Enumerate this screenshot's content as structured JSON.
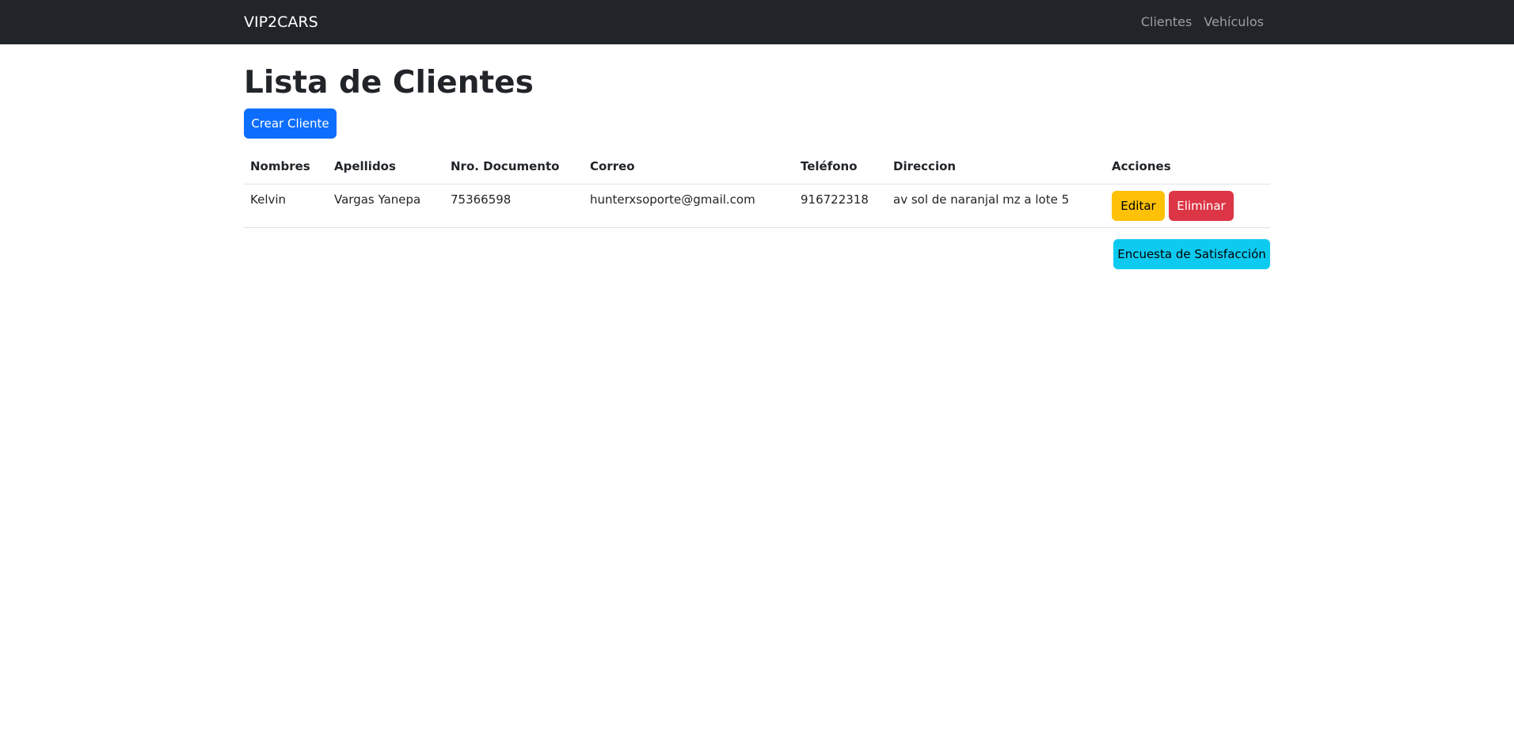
{
  "navbar": {
    "brand": "VIP2CARS",
    "links": [
      "Clientes",
      "Vehículos"
    ]
  },
  "page": {
    "title": "Lista de Clientes",
    "create_button": "Crear Cliente",
    "survey_button": "Encuesta de Satisfacción"
  },
  "table": {
    "headers": [
      "Nombres",
      "Apellidos",
      "Nro. Documento",
      "Correo",
      "Teléfono",
      "Direccion",
      "Acciones"
    ],
    "rows": [
      {
        "nombres": "Kelvin",
        "apellidos": "Vargas Yanepa",
        "documento": "75366598",
        "correo": "hunterxsoporte@gmail.com",
        "telefono": "916722318",
        "direccion": "av sol de naranjal mz a lote 5",
        "edit_label": "Editar",
        "delete_label": "Eliminar"
      }
    ]
  },
  "colors": {
    "navbar_bg": "#212529",
    "primary": "#0d6efd",
    "warning": "#ffc107",
    "danger": "#dc3545",
    "info": "#0dcaf0"
  }
}
